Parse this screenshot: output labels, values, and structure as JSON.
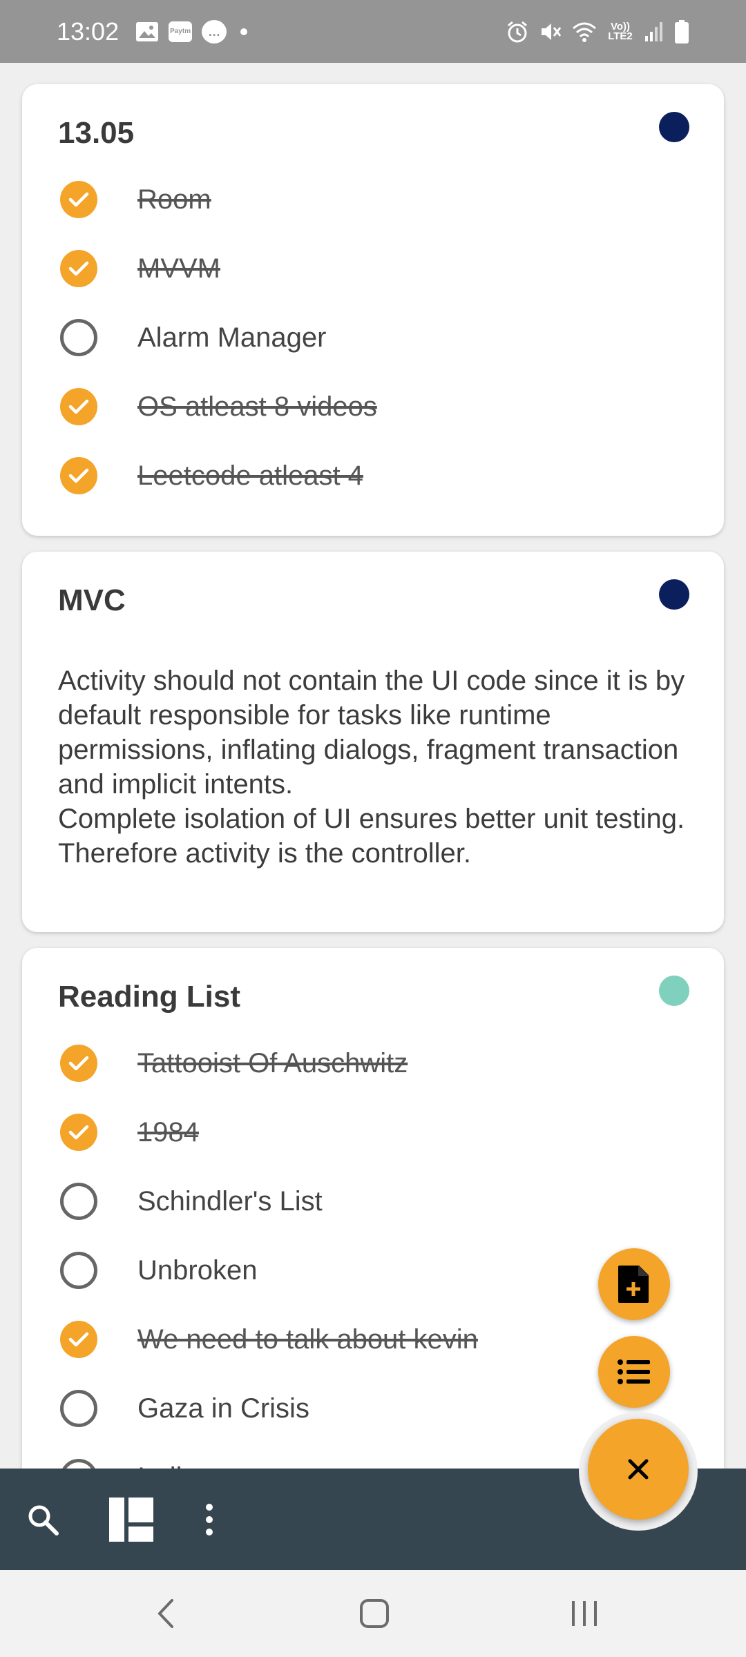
{
  "status_bar": {
    "time": "13:02",
    "notification_icons": [
      "image-icon",
      "paytm-icon",
      "message-icon"
    ],
    "paytm_label": "Paytm",
    "message_glyph": "…",
    "system_icons": [
      "alarm-icon",
      "mute-icon",
      "wifi-icon",
      "volte-icon",
      "signal-icon",
      "battery-icon"
    ],
    "volte_label": "Vo)) LTE2"
  },
  "cards": [
    {
      "type": "checklist",
      "title": "13.05",
      "color": "#0b1f5c",
      "items": [
        {
          "label": "Room",
          "checked": true
        },
        {
          "label": "MVVM",
          "checked": true
        },
        {
          "label": "Alarm Manager",
          "checked": false
        },
        {
          "label": "OS atleast 8 videos",
          "checked": true
        },
        {
          "label": "Leetcode atleast 4",
          "checked": true
        }
      ]
    },
    {
      "type": "note",
      "title": "MVC",
      "color": "#0b1f5c",
      "body": "Activity should not contain the UI code since it is by default responsible for tasks like runtime permissions, inflating dialogs, fragment transaction and implicit intents.\nComplete isolation of UI ensures better unit testing.\nTherefore activity is the controller."
    },
    {
      "type": "checklist",
      "title": "Reading List",
      "color": "#7fd1bd",
      "items": [
        {
          "label": "Tattooist Of Auschwitz ",
          "checked": true
        },
        {
          "label": "1984",
          "checked": true
        },
        {
          "label": "Schindler's List",
          "checked": false
        },
        {
          "label": "Unbroken",
          "checked": false
        },
        {
          "label": "We need to talk about kevin",
          "checked": true
        },
        {
          "label": "Gaza in Crisis",
          "checked": false
        },
        {
          "label": "Indi...",
          "checked": false
        }
      ]
    }
  ],
  "fab": {
    "color": "#f4a429",
    "new_note_icon": "note-add-icon",
    "new_list_icon": "list-icon",
    "close_icon": "close-icon"
  },
  "bottom_bar": {
    "color": "#364651",
    "icons": [
      "search-icon",
      "layout-icon",
      "more-vert-icon"
    ]
  },
  "system_nav": {
    "icons": [
      "back-icon",
      "home-icon",
      "recents-icon"
    ]
  }
}
